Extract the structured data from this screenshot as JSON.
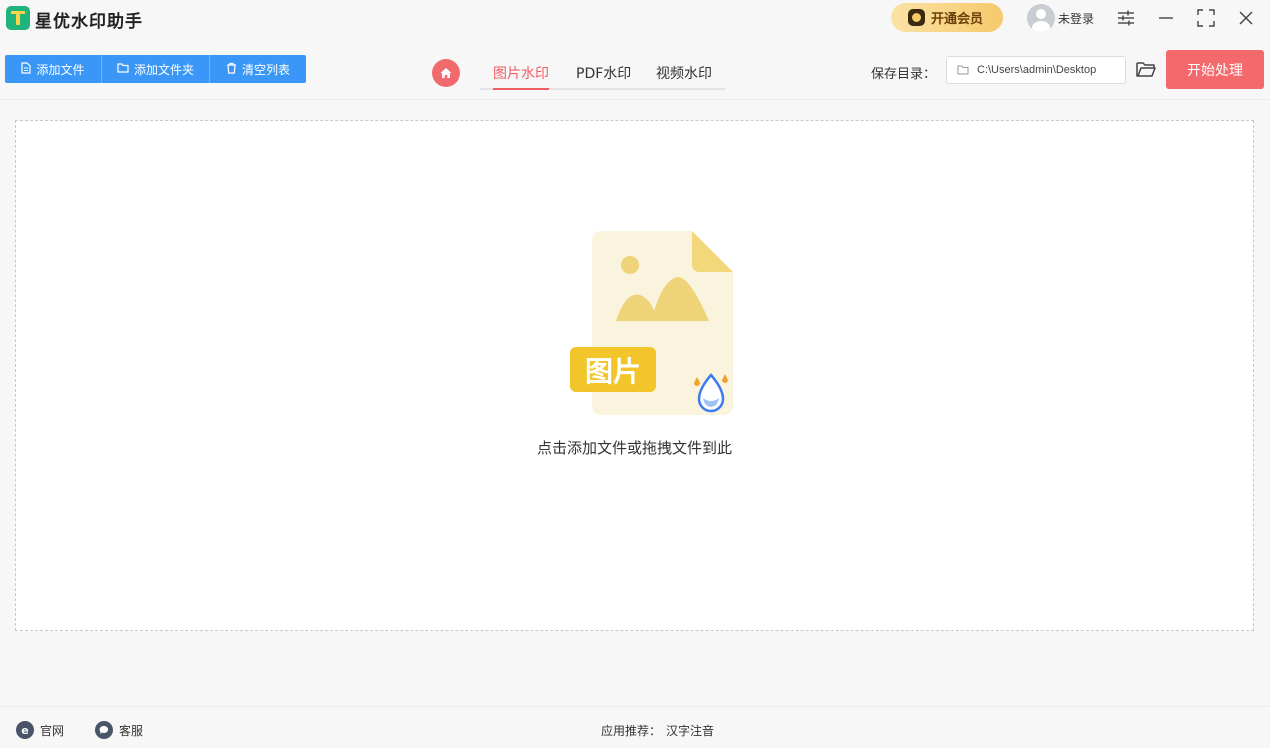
{
  "app": {
    "title": "星优水印助手",
    "vip_label": "开通会员",
    "login_label": "未登录"
  },
  "toolbar": {
    "add_file": "添加文件",
    "add_folder": "添加文件夹",
    "clear_list": "清空列表",
    "tabs": [
      "图片水印",
      "PDF水印",
      "视频水印"
    ],
    "active_tab": "图片水印",
    "save_label": "保存目录：",
    "save_path": "C:\\Users\\admin\\Desktop",
    "start_label": "开始处理"
  },
  "dropzone": {
    "badge_text": "图片",
    "hint": "点击添加文件或拖拽文件到此"
  },
  "footer": {
    "website": "官网",
    "service": "客服",
    "recommend_label": "应用推荐：",
    "recommend_app": "汉字注音"
  },
  "colors": {
    "primary_blue": "#3a97f7",
    "accent_red": "#f4696c",
    "vip_gold": "#f6c96a"
  }
}
